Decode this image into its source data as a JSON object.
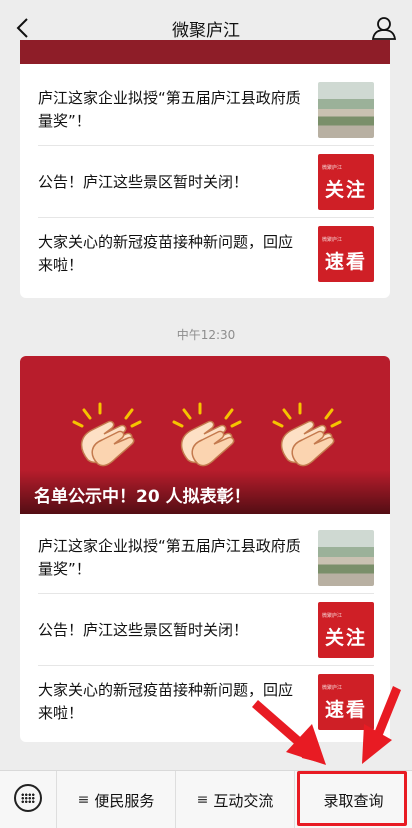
{
  "nav": {
    "title": "微聚庐江",
    "back_icon": "chevron-left-icon",
    "profile_icon": "person-icon"
  },
  "card1": {
    "items": [
      {
        "text": "庐江这家企业拟授“第五届庐江县政府质量奖”！",
        "thumb": "photo"
      },
      {
        "text": "公告！庐江这些景区暂时关闭！",
        "thumb": "red",
        "thumb_label": "关注",
        "thumb_mini": "微聚庐江"
      },
      {
        "text": "大家关心的新冠疫苗接种新问题，回应来啦！",
        "thumb": "red",
        "thumb_label": "速看",
        "thumb_mini": "微聚庐江"
      }
    ]
  },
  "timestamp": "中午12:30",
  "card2": {
    "banner_headline": "名单公示中！20 人拟表彰！",
    "items": [
      {
        "text": "庐江这家企业拟授“第五届庐江县政府质量奖”！",
        "thumb": "photo"
      },
      {
        "text": "公告！庐江这些景区暂时关闭！",
        "thumb": "red",
        "thumb_label": "关注",
        "thumb_mini": "微聚庐江"
      },
      {
        "text": "大家关心的新冠疫苗接种新问题，回应来啦！",
        "thumb": "red",
        "thumb_label": "速看",
        "thumb_mini": "微聚庐江"
      }
    ]
  },
  "tabbar": {
    "keyboard_icon": "keyboard-icon",
    "tabs": [
      {
        "label": "便民服务",
        "icon": "≡"
      },
      {
        "label": "互动交流",
        "icon": "≡"
      },
      {
        "label": "录取查询"
      }
    ]
  },
  "colors": {
    "brand_red": "#cf1f26",
    "highlight": "#e81b23",
    "banner": "#b81d2c"
  }
}
